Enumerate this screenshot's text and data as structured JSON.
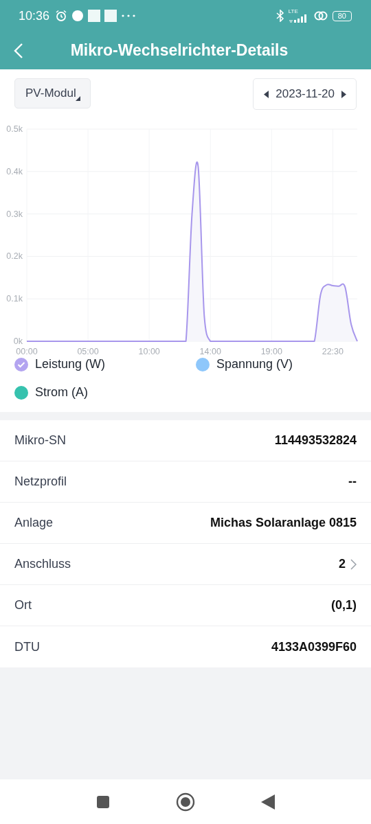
{
  "status_bar": {
    "time": "10:36",
    "network": "LTE",
    "battery": "80"
  },
  "header": {
    "title": "Mikro-Wechselrichter-Details"
  },
  "filters": {
    "module": "PV-Modul",
    "date": "2023-11-20"
  },
  "chart_data": {
    "type": "area",
    "yticks": [
      {
        "value": 0,
        "label": "0k"
      },
      {
        "value": 100,
        "label": "0.1k"
      },
      {
        "value": 200,
        "label": "0.2k"
      },
      {
        "value": 300,
        "label": "0.3k"
      },
      {
        "value": 400,
        "label": "0.4k"
      },
      {
        "value": 500,
        "label": "0.5k"
      }
    ],
    "ylim": [
      0,
      500
    ],
    "grid": true,
    "categories": [
      "00:00",
      null,
      null,
      null,
      null,
      null,
      null,
      null,
      null,
      null,
      "05:00",
      null,
      null,
      null,
      null,
      null,
      null,
      null,
      null,
      null,
      "10:00",
      null,
      null,
      null,
      null,
      null,
      null,
      null,
      null,
      null,
      "14:00",
      null,
      null,
      null,
      null,
      null,
      null,
      null,
      null,
      null,
      "19:00",
      null,
      null,
      null,
      null,
      null,
      null,
      null,
      null,
      null,
      "22:30",
      null,
      null,
      null,
      null
    ],
    "series": [
      {
        "color": "#a796ec",
        "values": [
          0,
          0,
          0,
          0,
          0,
          0,
          0,
          0,
          0,
          0,
          0,
          0,
          0,
          0,
          0,
          0,
          0,
          0,
          0,
          0,
          0,
          0,
          0,
          0,
          0,
          0,
          0,
          300,
          412,
          60,
          0,
          0,
          0,
          0,
          0,
          0,
          0,
          0,
          0,
          0,
          0,
          0,
          0,
          0,
          0,
          0,
          0,
          0,
          110,
          133,
          131,
          130,
          128,
          40,
          0
        ]
      }
    ]
  },
  "legend": [
    {
      "label": "Leistung (W)",
      "color": "#b3a4f0",
      "selected": true
    },
    {
      "label": "Spannung (V)",
      "color": "#8ec7fb",
      "selected": false
    },
    {
      "label": "Strom (A)",
      "color": "#36c2ae",
      "selected": false
    }
  ],
  "details": [
    {
      "label": "Mikro-SN",
      "value": "114493532824",
      "chevron": false
    },
    {
      "label": "Netzprofil",
      "value": "--",
      "chevron": false
    },
    {
      "label": "Anlage",
      "value": "Michas Solaranlage 0815",
      "chevron": false
    },
    {
      "label": "Anschluss",
      "value": "2",
      "chevron": true
    },
    {
      "label": "Ort",
      "value": "(0,1)",
      "chevron": false
    },
    {
      "label": "DTU",
      "value": "4133A0399F60",
      "chevron": false
    }
  ]
}
